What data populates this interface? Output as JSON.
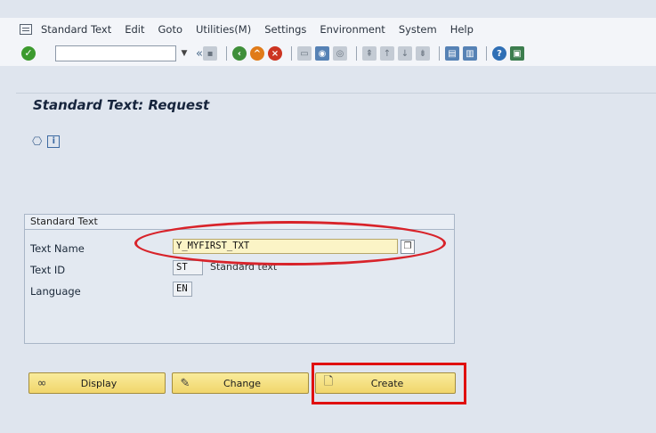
{
  "menubar": {
    "items": [
      "Standard Text",
      "Edit",
      "Goto",
      "Utilities(M)",
      "Settings",
      "Environment",
      "System",
      "Help"
    ]
  },
  "toolbar": {
    "command_field_value": "",
    "back_glyph": "«"
  },
  "page": {
    "title": "Standard Text: Request"
  },
  "groupbox": {
    "title": "Standard Text",
    "fields": [
      {
        "label": "Text Name",
        "value": "Y_MYFIRST_TXT"
      },
      {
        "label": "Text ID",
        "value": "ST",
        "description": "Standard text"
      },
      {
        "label": "Language",
        "value": "EN"
      }
    ]
  },
  "buttons": {
    "display": "Display",
    "change": "Change",
    "create": "Create"
  },
  "colors": {
    "highlight_red": "#d8232a",
    "button_yellow": "#f1d66b",
    "background": "#dfe5ee"
  }
}
